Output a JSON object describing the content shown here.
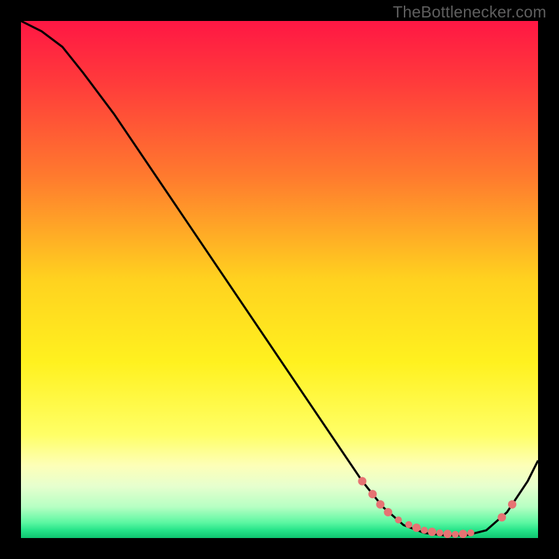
{
  "watermark": "TheBottlenecker.com",
  "chart_data": {
    "type": "line",
    "title": "",
    "xlabel": "",
    "ylabel": "",
    "xlim": [
      0,
      100
    ],
    "ylim": [
      0,
      100
    ],
    "series": [
      {
        "name": "curve",
        "x": [
          0,
          4,
          8,
          12,
          18,
          66,
          70,
          74,
          78,
          82,
          86,
          90,
          94,
          98,
          100
        ],
        "y": [
          100,
          98,
          95,
          90,
          82,
          11,
          6,
          2.5,
          1,
          0.5,
          0.5,
          1.5,
          5,
          11,
          15
        ]
      }
    ],
    "markers": {
      "name": "highlight-dots",
      "color": "#e67373",
      "points": [
        {
          "x": 66,
          "y": 11
        },
        {
          "x": 68,
          "y": 8.5
        },
        {
          "x": 69.5,
          "y": 6.5
        },
        {
          "x": 71,
          "y": 5
        },
        {
          "x": 73,
          "y": 3.5,
          "r": 5
        },
        {
          "x": 75,
          "y": 2.6,
          "r": 5
        },
        {
          "x": 76.5,
          "y": 2
        },
        {
          "x": 78,
          "y": 1.5,
          "r": 5
        },
        {
          "x": 79.5,
          "y": 1.2
        },
        {
          "x": 81,
          "y": 1,
          "r": 5
        },
        {
          "x": 82.5,
          "y": 0.8
        },
        {
          "x": 84,
          "y": 0.7,
          "r": 5
        },
        {
          "x": 85.5,
          "y": 0.8
        },
        {
          "x": 87,
          "y": 1,
          "r": 5
        },
        {
          "x": 93,
          "y": 4
        },
        {
          "x": 95,
          "y": 6.5
        }
      ]
    },
    "gradient_stops": [
      {
        "offset": 0.0,
        "color": "#ff1744"
      },
      {
        "offset": 0.12,
        "color": "#ff3b3b"
      },
      {
        "offset": 0.3,
        "color": "#ff7a2e"
      },
      {
        "offset": 0.5,
        "color": "#ffd21f"
      },
      {
        "offset": 0.66,
        "color": "#fff11f"
      },
      {
        "offset": 0.8,
        "color": "#ffff66"
      },
      {
        "offset": 0.86,
        "color": "#fdffb8"
      },
      {
        "offset": 0.9,
        "color": "#e6ffce"
      },
      {
        "offset": 0.94,
        "color": "#b6ffc3"
      },
      {
        "offset": 0.97,
        "color": "#5cf7a2"
      },
      {
        "offset": 0.985,
        "color": "#25e489"
      },
      {
        "offset": 1.0,
        "color": "#0fc571"
      }
    ]
  }
}
